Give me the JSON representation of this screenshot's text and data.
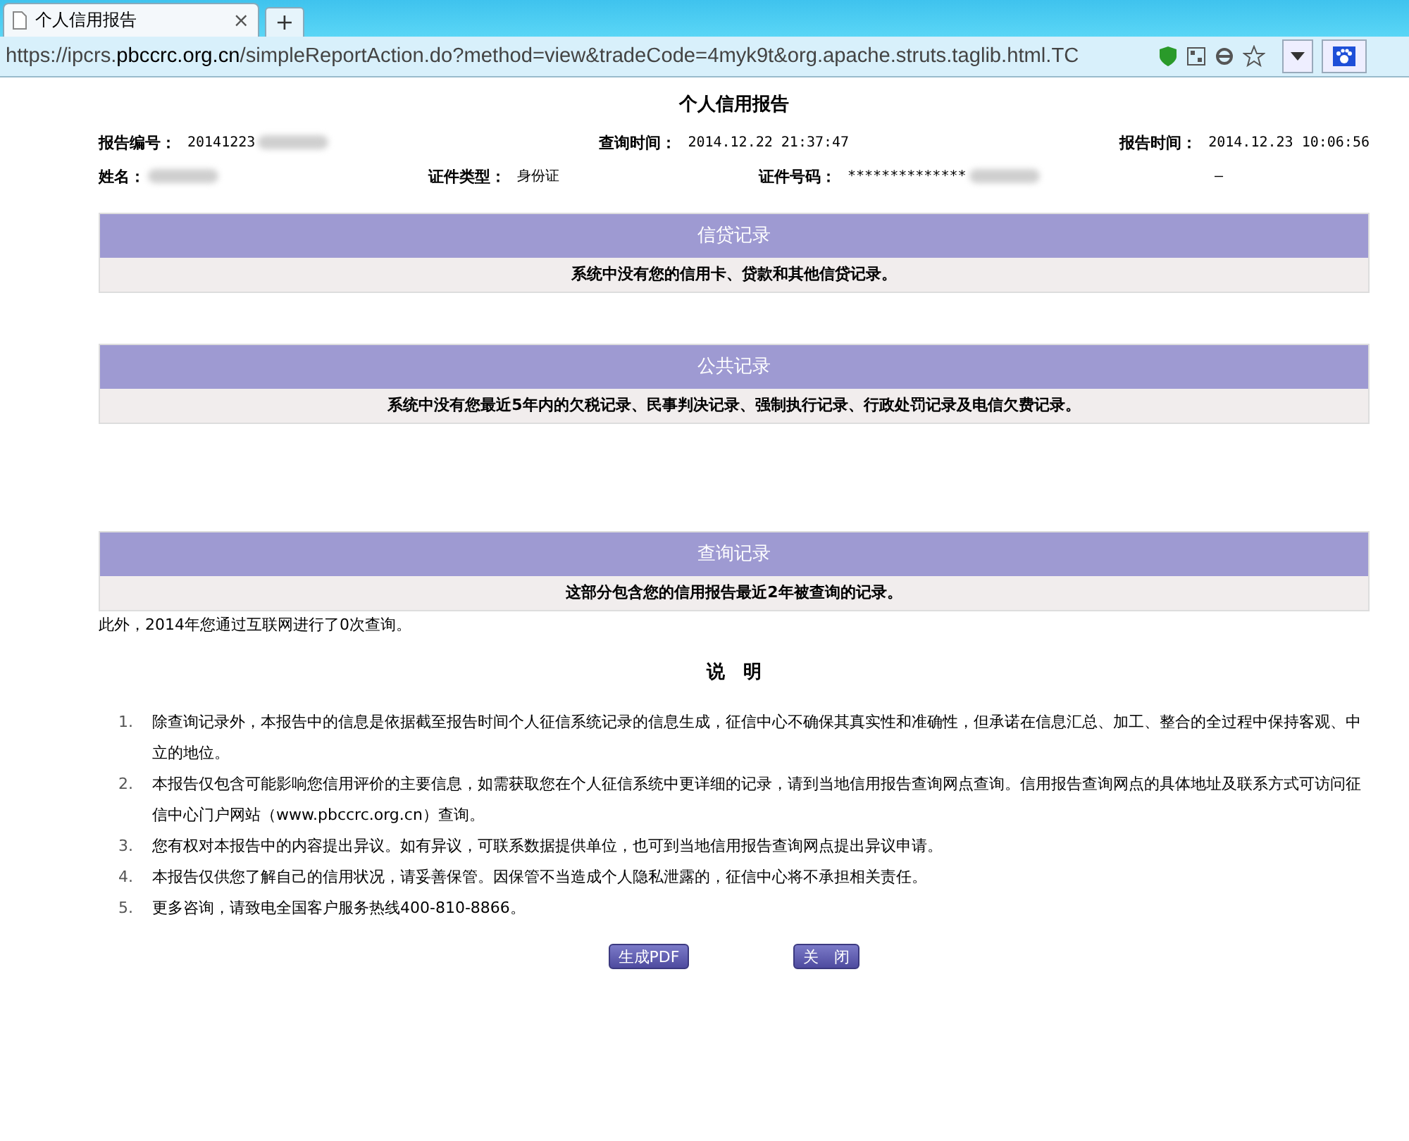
{
  "browser": {
    "tab": {
      "title": "个人信用报告",
      "close": "×"
    },
    "new_tab": "+",
    "url": {
      "prefix": "https://ipcrs.",
      "host": "pbccrc.org.cn",
      "path": "/simpleReportAction.do?method=view&tradeCode=4myk9t&org.apache.struts.taglib.html.TC"
    }
  },
  "report": {
    "title": "个人信用报告",
    "header_row_1": [
      {
        "label": "报告编号：",
        "value": "20141223",
        "redacted": true
      },
      {
        "label": "查询时间：",
        "value": "2014.12.22 21:37:47",
        "redacted": false
      },
      {
        "label": "报告时间：",
        "value": "2014.12.23 10:06:56",
        "redacted": false
      }
    ],
    "header_row_2": [
      {
        "label": "姓名：",
        "redacted": true
      },
      {
        "label": "证件类型：",
        "value": "身份证",
        "redacted": false
      },
      {
        "label": "证件号码：",
        "value": "**************",
        "redacted": true
      },
      {
        "value": "—",
        "redacted": false
      }
    ],
    "sections": [
      {
        "title": "信贷记录",
        "body": "系统中没有您的信用卡、贷款和其他信贷记录。"
      },
      {
        "title": "公共记录",
        "body": "系统中没有您最近5年内的欠税记录、民事判决记录、强制执行记录、行政处罚记录及电信欠费记录。"
      },
      {
        "title": "查询记录",
        "body": "这部分包含您的信用报告最近2年被查询的记录。"
      }
    ],
    "extra_note": "此外，2014年您通过互联网进行了0次查询。",
    "notes_title": "说　明",
    "notes": [
      {
        "marker": "1.",
        "text": "除查询记录外，本报告中的信息是依据截至报告时间个人征信系统记录的信息生成，征信中心不确保其真实性和准确性，但承诺在信息汇总、加工、整合的全过程中保持客观、中立的地位。"
      },
      {
        "marker": "2.",
        "text": "本报告仅包含可能影响您信用评价的主要信息，如需获取您在个人征信系统中更详细的记录，请到当地信用报告查询网点查询。信用报告查询网点的具体地址及联系方式可访问征信中心门户网站（www.pbccrc.org.cn）查询。"
      },
      {
        "marker": "3.",
        "text": "您有权对本报告中的内容提出异议。如有异议，可联系数据提供单位，也可到当地信用报告查询网点提出异议申请。"
      },
      {
        "marker": "4.",
        "text": "本报告仅供您了解自己的信用状况，请妥善保管。因保管不当造成个人隐私泄露的，征信中心将不承担相关责任。"
      },
      {
        "marker": "5.",
        "text": "更多咨询，请致电全国客户服务热线400-810-8866。"
      }
    ],
    "buttons": [
      "生成PDF",
      "关　闭"
    ]
  }
}
